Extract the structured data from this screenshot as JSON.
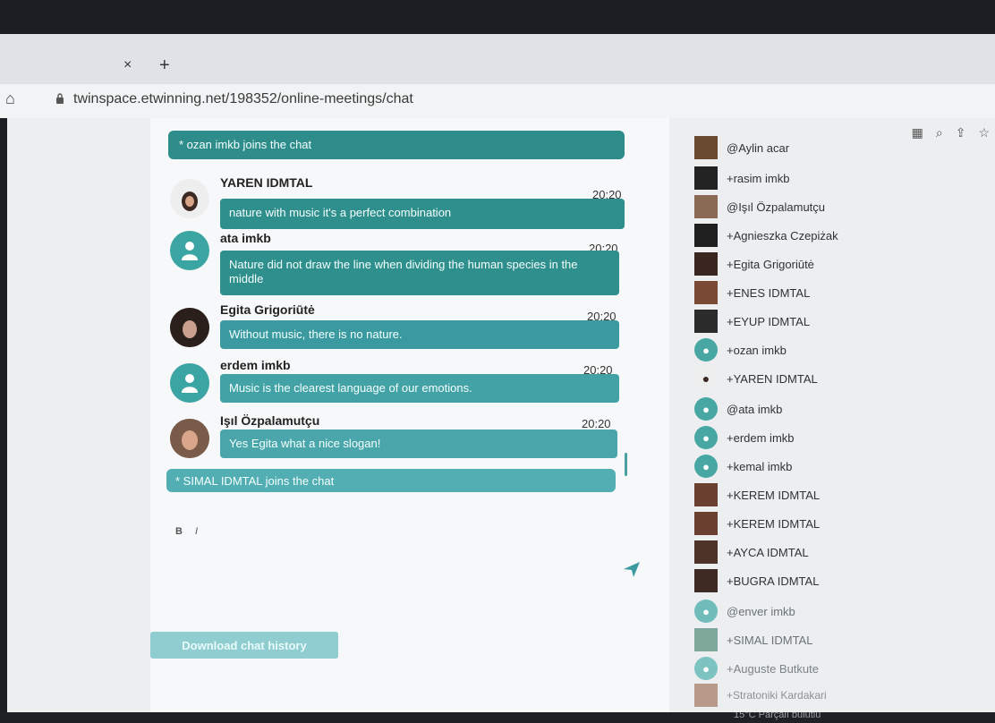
{
  "browser": {
    "tab_close": "×",
    "tab_new": "+",
    "url": "twinspace.etwinning.net/198352/online-meetings/chat"
  },
  "chat": {
    "system_messages": [
      "* ozan imkb joins the chat",
      "* SIMAL IDMTAL joins the chat"
    ],
    "messages": [
      {
        "name": "YAREN IDMTAL",
        "time": "20:20",
        "text": "nature with music it's a perfect combination"
      },
      {
        "name": "ata imkb",
        "time": "20:20",
        "text": "Nature did not draw the line when dividing the human species in the middle"
      },
      {
        "name": "Egita Grigoriūtė",
        "time": "20:20",
        "text": "Without music, there is no nature."
      },
      {
        "name": "erdem imkb",
        "time": "20:20",
        "text": "Music is the clearest language of our emotions."
      },
      {
        "name": "Işıl Özpalamutçu",
        "time": "20:20",
        "text": "Yes Egita what a nice slogan!"
      }
    ],
    "format_bold": "B",
    "format_italic": "I",
    "download_label": "Download chat history"
  },
  "participants": [
    "@Aylin acar",
    "+rasim imkb",
    "@Işıl Özpalamutçu",
    "+Agnieszka Czepiżak",
    "+Egita Grigoriūtė",
    "+ENES IDMTAL",
    "+EYUP IDMTAL",
    "+ozan imkb",
    "+YAREN IDMTAL",
    "@ata imkb",
    "+erdem imkb",
    "+kemal imkb",
    "+KEREM IDMTAL",
    "+KEREM IDMTAL",
    "+AYCA IDMTAL",
    "+BUGRA IDMTAL",
    "@enver imkb",
    "+SIMAL IDMTAL",
    "+Auguste Butkute",
    "+Stratoniki Kardakari"
  ],
  "taskbar": {
    "weather": "15°C  Parçalı bulutlu"
  },
  "colors": {
    "accent": "#2f8f8c",
    "light_accent": "#8fcdd0"
  }
}
